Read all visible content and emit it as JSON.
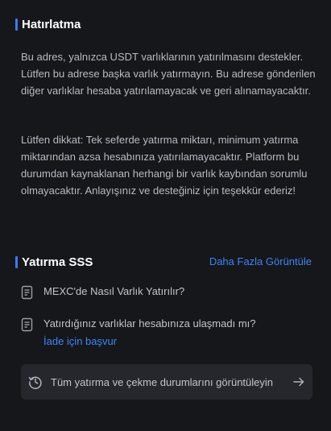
{
  "reminder": {
    "title": "Hatırlatma",
    "paragraph1": "Bu adres, yalnızca USDT varlıklarının yatırılmasını destekler. Lütfen bu adrese başka varlık yatırmayın. Bu adrese gönderilen diğer varlıklar hesaba yatırılamayacak ve geri alınamayacaktır.",
    "paragraph2": "Lütfen dikkat: Tek seferde yatırma miktarı, minimum yatırma miktarından azsa hesabınıza yatırılamayacaktır. Platform bu durumdan kaynaklanan herhangi bir varlık kaybından sorumlu olmayacaktır. Anlayışınız ve desteğiniz için teşekkür ederiz!"
  },
  "faq": {
    "title": "Yatırma SSS",
    "more_label": "Daha Fazla Görüntüle",
    "items": [
      {
        "label": "MEXC'de Nasıl Varlık Yatırılır?"
      },
      {
        "label": "Yatırdığınız varlıklar hesabınıza ulaşmadı mı?",
        "sub_link": "İade için başvur"
      }
    ],
    "status_button_label": "Tüm yatırma ve çekme durumlarını görüntüleyin"
  },
  "colors": {
    "background": "#16171b",
    "accent": "#3d7af5",
    "link": "#3d86f5",
    "button_bg": "#26272c"
  }
}
